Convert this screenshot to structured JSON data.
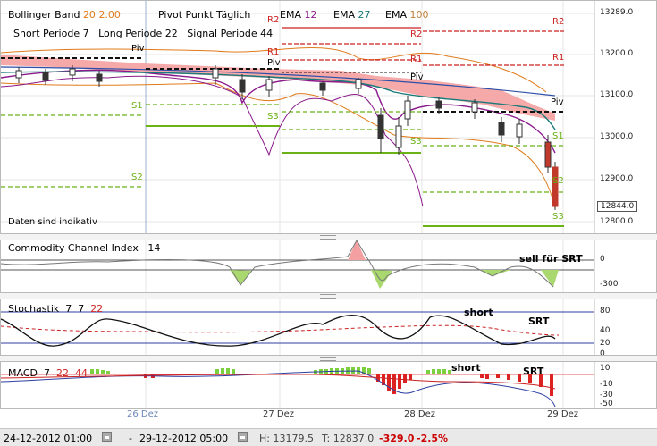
{
  "main": {
    "bollinger": {
      "name": "Bollinger Band",
      "p1": "20",
      "p2": "2.00"
    },
    "pivot_label": "Pivot Punkt Täglich",
    "ema": {
      "prefix": "EMA",
      "v1": "12",
      "v2": "27",
      "v3": "100"
    },
    "macd_params": {
      "short": "Short Periode",
      "short_v": "7",
      "long": "Long Periode",
      "long_v": "22",
      "signal": "Signal Periode",
      "signal_v": "44"
    },
    "disclaimer": "Daten sind indikativ",
    "price_axis": [
      "13289.0",
      "13200.0",
      "13100.0",
      "13000.0",
      "12900.0",
      "12844.0",
      "12800.0"
    ],
    "pivot_tags": {
      "r2": "R2",
      "r1": "R1",
      "piv": "Piv",
      "s1": "S1",
      "s2": "S2",
      "s3": "S3"
    },
    "colors": {
      "bb": "#e07b1b",
      "ema12": "#8b1a8b",
      "ema27": "#1a7a7a",
      "ema100": "#c07f3a",
      "pivot_r": "#cc2222",
      "pivot_s": "#6ab216",
      "cloud": "#f4a0a0"
    }
  },
  "cci": {
    "label": "Commodity Channel Index",
    "value": "14",
    "annotation": "sell für SRT",
    "axis": [
      "0",
      "-300"
    ]
  },
  "stoch": {
    "label": "Stochastik",
    "v1": "7",
    "v2": "7",
    "v3": "22",
    "annotation_short": "short",
    "annotation_srt": "SRT",
    "axis": [
      "80",
      "40",
      "20",
      "0"
    ]
  },
  "macd": {
    "label": "MACD",
    "v1": "7",
    "v2": "22",
    "v3": "44",
    "annotation_short": "short",
    "annotation_srt": "SRT",
    "axis": [
      "10",
      "-10",
      "-30",
      "-50"
    ]
  },
  "xaxis": [
    "26 Dez",
    "27 Dez",
    "28 Dez",
    "29 Dez"
  ],
  "footer": {
    "from": "24-12-2012 01:00",
    "dash": "-",
    "to": "29-12-2012 05:00",
    "high": "H: 13179.5",
    "low": "T: 12837.0",
    "change": "-329.0",
    "pct": "-2.5%"
  }
}
